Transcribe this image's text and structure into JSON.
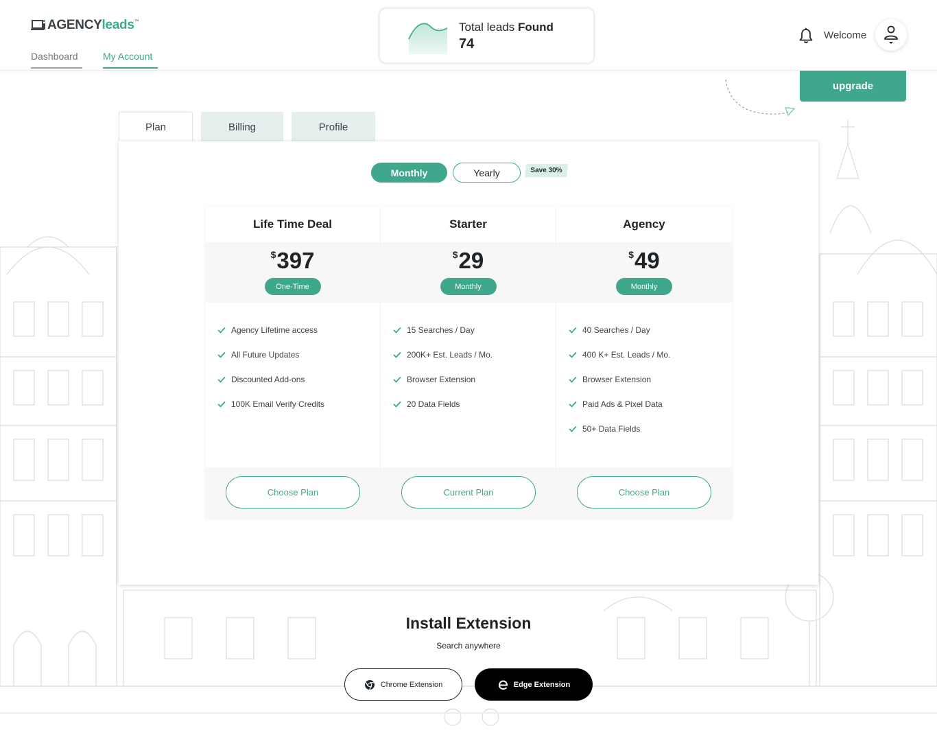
{
  "header": {
    "logo": {
      "part1": "AGENCY",
      "part2": "leads",
      "tm": "™"
    },
    "nav": [
      {
        "label": "Dashboard"
      },
      {
        "label": "My Account"
      }
    ],
    "leads_card": {
      "title_prefix": "Total leads ",
      "title_bold": "Found",
      "count": "74"
    },
    "welcome": "Welcome",
    "icons": {
      "bell": "bell-icon",
      "user": "user-icon"
    },
    "upgrade_label": "upgrade"
  },
  "tabs": [
    {
      "label": "Plan"
    },
    {
      "label": "Billing"
    },
    {
      "label": "Profile"
    }
  ],
  "billing_toggle": {
    "monthly": "Monthly",
    "yearly": "Yearly",
    "save": "Save 30%"
  },
  "plans": [
    {
      "name": "Life Time Deal",
      "currency": "$",
      "price": "397",
      "period": "One-Time",
      "features": [
        "Agency Lifetime access",
        "All Future Updates",
        "Discounted Add-ons",
        "100K Email Verify Credits"
      ],
      "button": "Choose Plan"
    },
    {
      "name": "Starter",
      "currency": "$",
      "price": "29",
      "period": "Monthly",
      "features": [
        "15 Searches / Day",
        "200K+ Est. Leads / Mo.",
        "Browser Extension",
        "20 Data Fields"
      ],
      "button": "Current Plan"
    },
    {
      "name": "Agency",
      "currency": "$",
      "price": "49",
      "period": "Monthly",
      "features": [
        "40 Searches / Day",
        "400 K+ Est. Leads / Mo.",
        "Browser Extension",
        "Paid Ads & Pixel Data",
        "50+ Data Fields"
      ],
      "button": "Choose Plan"
    }
  ],
  "install": {
    "title": "Install Extension",
    "subtitle": "Search anywhere",
    "chrome": "Chrome Extension",
    "edge": "Edge Extension"
  },
  "colors": {
    "accent": "#3fa88c",
    "tab_inactive": "#e5efee",
    "panel_grey": "#f7f7f7"
  }
}
